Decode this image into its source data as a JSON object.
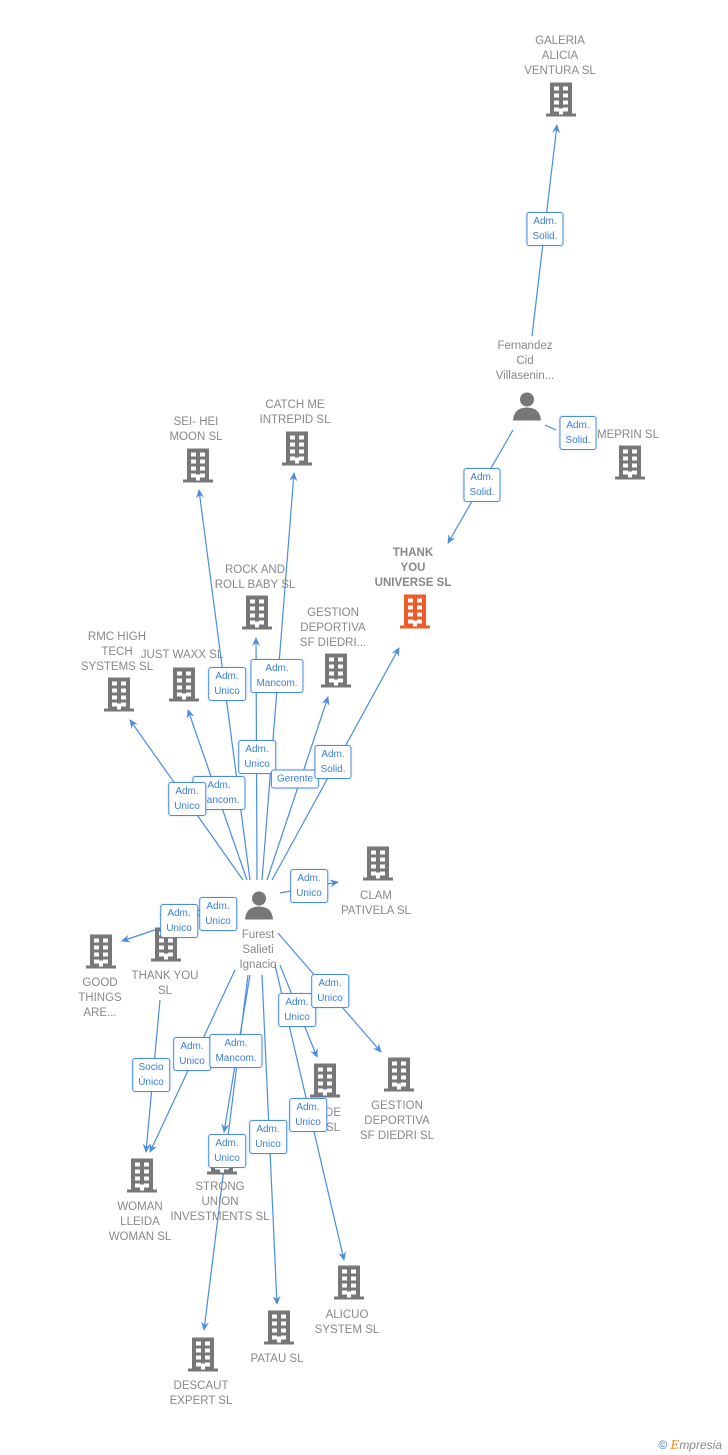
{
  "colors": {
    "edge": "#4a8de0",
    "company": "#777777",
    "highlight": "#f05a28",
    "label": "#888888"
  },
  "nodes": [
    {
      "id": "galeria",
      "type": "company",
      "lines": [
        "GALERIA",
        "ALICIA",
        "VENTURA SL"
      ]
    },
    {
      "id": "fernandez",
      "type": "person",
      "lines": [
        "Fernandez",
        "Cid",
        "Villasenin..."
      ]
    },
    {
      "id": "meprin",
      "type": "company",
      "lines": [
        "MEPRIN SL"
      ]
    },
    {
      "id": "universe",
      "type": "company",
      "highlight": true,
      "lines": [
        "THANK",
        "YOU",
        "UNIVERSE  SL"
      ]
    },
    {
      "id": "seihei",
      "type": "company",
      "lines": [
        "SEI- HEI",
        "MOON  SL"
      ]
    },
    {
      "id": "catchme",
      "type": "company",
      "lines": [
        "CATCH ME",
        "INTREPID  SL"
      ]
    },
    {
      "id": "rock",
      "type": "company",
      "lines": [
        "ROCK AND",
        "ROLL BABY  SL"
      ]
    },
    {
      "id": "gestiontop",
      "type": "company",
      "lines": [
        "GESTION",
        "DEPORTIVA",
        "SF DIEDRI..."
      ]
    },
    {
      "id": "rmc",
      "type": "company",
      "lines": [
        "RMC HIGH",
        "TECH",
        "SYSTEMS  SL"
      ]
    },
    {
      "id": "justwaxx",
      "type": "company",
      "lines": [
        "JUST WAXX SL"
      ]
    },
    {
      "id": "clam",
      "type": "company",
      "lines": [
        "CLAM",
        "PATIVELA  SL"
      ]
    },
    {
      "id": "furest",
      "type": "person",
      "lines": [
        "Furest",
        "Salieti",
        "Ignacio"
      ]
    },
    {
      "id": "goodthings",
      "type": "company",
      "lines": [
        "GOOD",
        "THINGS",
        "ARE..."
      ]
    },
    {
      "id": "thankyousl",
      "type": "company",
      "lines": [
        "THANK YOU",
        "SL"
      ]
    },
    {
      "id": "gestionbottom",
      "type": "company",
      "lines": [
        "GESTION",
        "DEPORTIVA",
        "SF DIEDRI  SL"
      ]
    },
    {
      "id": "desl",
      "type": "company",
      "lines": [
        "DE",
        "SL"
      ]
    },
    {
      "id": "woman",
      "type": "company",
      "lines": [
        "WOMAN",
        "LLEIDA",
        "WOMAN SL"
      ]
    },
    {
      "id": "strong",
      "type": "company",
      "lines": [
        "STRONG",
        "UNION",
        "INVESTMENTS SL"
      ]
    },
    {
      "id": "alicuo",
      "type": "company",
      "lines": [
        "ALICUO",
        "SYSTEM SL"
      ]
    },
    {
      "id": "patau",
      "type": "company",
      "lines": [
        "PATAU SL"
      ]
    },
    {
      "id": "descaut",
      "type": "company",
      "lines": [
        "DESCAUT",
        "EXPERT SL"
      ]
    }
  ],
  "edges": [
    {
      "from": "fernandez",
      "to": "galeria",
      "label": [
        "Adm.",
        "Solid."
      ]
    },
    {
      "from": "fernandez",
      "to": "universe",
      "label": [
        "Adm.",
        "Solid."
      ]
    },
    {
      "from": "fernandez",
      "to": "meprin",
      "label": [
        "Adm.",
        "Solid."
      ]
    },
    {
      "from": "furest",
      "to": "seihei",
      "label": [
        "Adm.",
        "Unico"
      ]
    },
    {
      "from": "furest",
      "to": "catchme",
      "label": [
        "Adm.",
        "Mancom."
      ]
    },
    {
      "from": "furest",
      "to": "rock",
      "label": [
        "Adm.",
        "Unico"
      ]
    },
    {
      "from": "furest",
      "to": "gestiontop",
      "label": [
        "Gerente"
      ]
    },
    {
      "from": "furest",
      "to": "universe",
      "label": [
        "Adm.",
        "Solid."
      ]
    },
    {
      "from": "furest",
      "to": "justwaxx",
      "label": [
        "Adm.",
        "Mancom."
      ]
    },
    {
      "from": "furest",
      "to": "rmc",
      "label": [
        "Adm.",
        "Unico"
      ]
    },
    {
      "from": "furest",
      "to": "clam",
      "label": [
        "Adm.",
        "Unico"
      ]
    },
    {
      "from": "furest",
      "to": "thankyousl",
      "label": [
        "Adm.",
        "Unico"
      ]
    },
    {
      "from": "furest",
      "to": "goodthings",
      "label": [
        "Adm.",
        "Unico"
      ]
    },
    {
      "from": "thankyousl",
      "to": "woman",
      "label": [
        "Socio",
        "Único"
      ]
    },
    {
      "from": "furest",
      "to": "woman",
      "label": [
        "Adm.",
        "Unico"
      ]
    },
    {
      "from": "furest",
      "to": "strong",
      "label": [
        "Adm.",
        "Mancom."
      ]
    },
    {
      "from": "furest",
      "to": "descaut",
      "label": [
        "Adm.",
        "Unico"
      ]
    },
    {
      "from": "furest",
      "to": "patau",
      "label": [
        "Adm.",
        "Unico"
      ]
    },
    {
      "from": "furest",
      "to": "alicuo",
      "label": [
        "Adm.",
        "Unico"
      ]
    },
    {
      "from": "furest",
      "to": "desl",
      "label": [
        "Adm.",
        "Unico"
      ]
    },
    {
      "from": "furest",
      "to": "gestionbottom",
      "label": [
        "Adm.",
        "Unico"
      ]
    }
  ],
  "footer": {
    "copyright": "©",
    "brand": "E",
    "brand_rest": "mpresia"
  }
}
